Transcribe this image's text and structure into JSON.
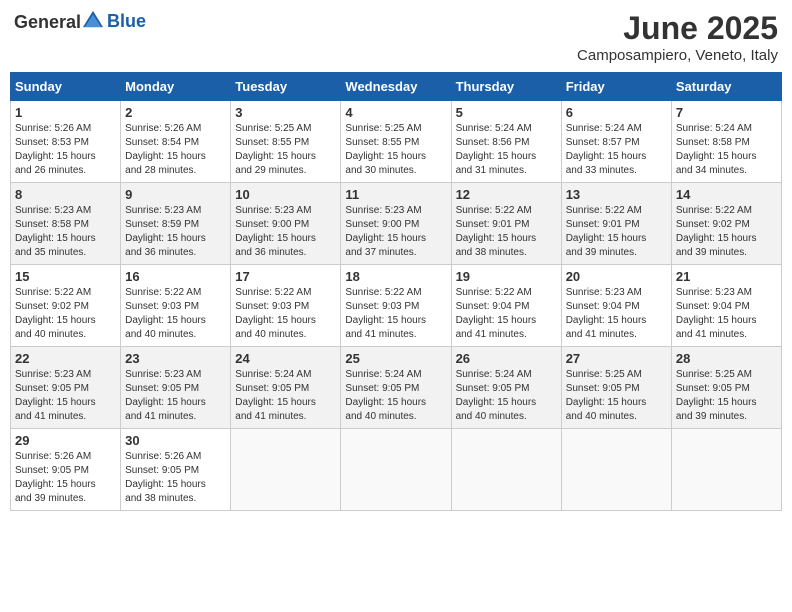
{
  "header": {
    "logo": {
      "text_general": "General",
      "text_blue": "Blue"
    },
    "month_title": "June 2025",
    "location": "Camposampiero, Veneto, Italy"
  },
  "calendar": {
    "days_of_week": [
      "Sunday",
      "Monday",
      "Tuesday",
      "Wednesday",
      "Thursday",
      "Friday",
      "Saturday"
    ],
    "weeks": [
      [
        null,
        null,
        null,
        null,
        null,
        null,
        null
      ]
    ],
    "cells": [
      {
        "day": "1",
        "sunrise": "5:26 AM",
        "sunset": "8:53 PM",
        "daylight": "15 hours and 26 minutes."
      },
      {
        "day": "2",
        "sunrise": "5:26 AM",
        "sunset": "8:54 PM",
        "daylight": "15 hours and 28 minutes."
      },
      {
        "day": "3",
        "sunrise": "5:25 AM",
        "sunset": "8:55 PM",
        "daylight": "15 hours and 29 minutes."
      },
      {
        "day": "4",
        "sunrise": "5:25 AM",
        "sunset": "8:55 PM",
        "daylight": "15 hours and 30 minutes."
      },
      {
        "day": "5",
        "sunrise": "5:24 AM",
        "sunset": "8:56 PM",
        "daylight": "15 hours and 31 minutes."
      },
      {
        "day": "6",
        "sunrise": "5:24 AM",
        "sunset": "8:57 PM",
        "daylight": "15 hours and 33 minutes."
      },
      {
        "day": "7",
        "sunrise": "5:24 AM",
        "sunset": "8:58 PM",
        "daylight": "15 hours and 34 minutes."
      },
      {
        "day": "8",
        "sunrise": "5:23 AM",
        "sunset": "8:58 PM",
        "daylight": "15 hours and 35 minutes."
      },
      {
        "day": "9",
        "sunrise": "5:23 AM",
        "sunset": "8:59 PM",
        "daylight": "15 hours and 36 minutes."
      },
      {
        "day": "10",
        "sunrise": "5:23 AM",
        "sunset": "9:00 PM",
        "daylight": "15 hours and 36 minutes."
      },
      {
        "day": "11",
        "sunrise": "5:23 AM",
        "sunset": "9:00 PM",
        "daylight": "15 hours and 37 minutes."
      },
      {
        "day": "12",
        "sunrise": "5:22 AM",
        "sunset": "9:01 PM",
        "daylight": "15 hours and 38 minutes."
      },
      {
        "day": "13",
        "sunrise": "5:22 AM",
        "sunset": "9:01 PM",
        "daylight": "15 hours and 39 minutes."
      },
      {
        "day": "14",
        "sunrise": "5:22 AM",
        "sunset": "9:02 PM",
        "daylight": "15 hours and 39 minutes."
      },
      {
        "day": "15",
        "sunrise": "5:22 AM",
        "sunset": "9:02 PM",
        "daylight": "15 hours and 40 minutes."
      },
      {
        "day": "16",
        "sunrise": "5:22 AM",
        "sunset": "9:03 PM",
        "daylight": "15 hours and 40 minutes."
      },
      {
        "day": "17",
        "sunrise": "5:22 AM",
        "sunset": "9:03 PM",
        "daylight": "15 hours and 40 minutes."
      },
      {
        "day": "18",
        "sunrise": "5:22 AM",
        "sunset": "9:03 PM",
        "daylight": "15 hours and 41 minutes."
      },
      {
        "day": "19",
        "sunrise": "5:22 AM",
        "sunset": "9:04 PM",
        "daylight": "15 hours and 41 minutes."
      },
      {
        "day": "20",
        "sunrise": "5:23 AM",
        "sunset": "9:04 PM",
        "daylight": "15 hours and 41 minutes."
      },
      {
        "day": "21",
        "sunrise": "5:23 AM",
        "sunset": "9:04 PM",
        "daylight": "15 hours and 41 minutes."
      },
      {
        "day": "22",
        "sunrise": "5:23 AM",
        "sunset": "9:05 PM",
        "daylight": "15 hours and 41 minutes."
      },
      {
        "day": "23",
        "sunrise": "5:23 AM",
        "sunset": "9:05 PM",
        "daylight": "15 hours and 41 minutes."
      },
      {
        "day": "24",
        "sunrise": "5:24 AM",
        "sunset": "9:05 PM",
        "daylight": "15 hours and 41 minutes."
      },
      {
        "day": "25",
        "sunrise": "5:24 AM",
        "sunset": "9:05 PM",
        "daylight": "15 hours and 40 minutes."
      },
      {
        "day": "26",
        "sunrise": "5:24 AM",
        "sunset": "9:05 PM",
        "daylight": "15 hours and 40 minutes."
      },
      {
        "day": "27",
        "sunrise": "5:25 AM",
        "sunset": "9:05 PM",
        "daylight": "15 hours and 40 minutes."
      },
      {
        "day": "28",
        "sunrise": "5:25 AM",
        "sunset": "9:05 PM",
        "daylight": "15 hours and 39 minutes."
      },
      {
        "day": "29",
        "sunrise": "5:26 AM",
        "sunset": "9:05 PM",
        "daylight": "15 hours and 39 minutes."
      },
      {
        "day": "30",
        "sunrise": "5:26 AM",
        "sunset": "9:05 PM",
        "daylight": "15 hours and 38 minutes."
      }
    ],
    "start_dow": 0,
    "labels": {
      "sunrise": "Sunrise:",
      "sunset": "Sunset:",
      "daylight": "Daylight:"
    }
  }
}
